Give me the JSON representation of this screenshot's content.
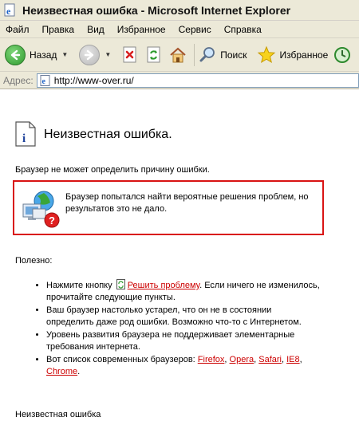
{
  "window": {
    "title": "Неизвестная ошибка - Microsoft Internet Explorer"
  },
  "menu": {
    "items": [
      "Файл",
      "Правка",
      "Вид",
      "Избранное",
      "Сервис",
      "Справка"
    ]
  },
  "toolbar": {
    "back_label": "Назад",
    "search_label": "Поиск",
    "favorites_label": "Избранное"
  },
  "address": {
    "label": "Адрес:",
    "url": "http://www-over.ru/"
  },
  "page": {
    "heading": "Неизвестная ошибка.",
    "subtitle": "Браузер не может определить причину ошибки.",
    "alert_line1": "Браузер попытался найти вероятные решения проблем, но",
    "alert_line2": "результатов это не дало.",
    "useful_label": "Полезно:",
    "tip1_before": "Нажмите кнопку",
    "tip1_link": "Решить проблему",
    "tip1_after": ". Если ничего не изменилось,",
    "tip1_line2": "прочитайте следующие пункты.",
    "tip2_line1": "Ваш браузер настолько устарел, что он не в состоянии",
    "tip2_line2": "определить даже род ошибки. Возможно что-то с Интернетом.",
    "tip3_line1": "Уровень развития браузера не поддерживает элементарные",
    "tip3_line2": "требования интернета.",
    "tip4_before": "Вот список современных браузеров:",
    "browsers": [
      "Firefox",
      "Opera",
      "Safari",
      "IE8",
      "Chrome"
    ],
    "footer": "Неизвестная ошибка"
  },
  "colors": {
    "chrome_bg": "#ece9d8",
    "alert_border": "#d91414",
    "link": "#cc0000"
  }
}
